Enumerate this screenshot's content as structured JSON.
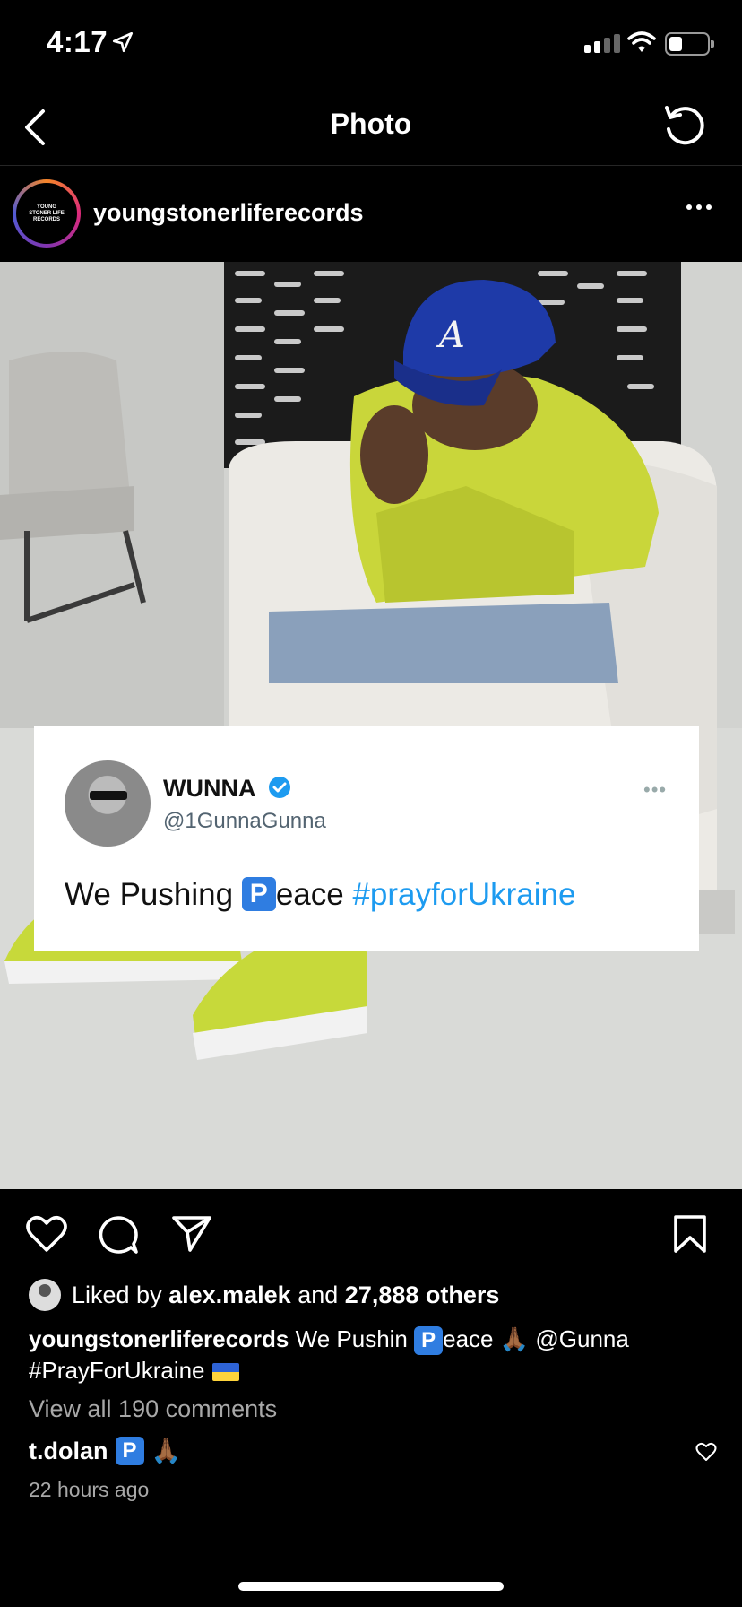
{
  "status_bar": {
    "time": "4:17"
  },
  "nav": {
    "title": "Photo"
  },
  "post": {
    "username": "youngstonerliferecords",
    "avatar_text": "YOUNG STONER LIFE RECORDS"
  },
  "tweet": {
    "name": "WUNNA",
    "handle": "@1GunnaGunna",
    "more": "•••",
    "text_before": "We Pushing",
    "p_letter": "P",
    "text_after": "eace",
    "hashtag": "#prayforUkraine"
  },
  "likes": {
    "prefix": "Liked by",
    "liker": "alex.malek",
    "connector": "and",
    "others": "27,888 others"
  },
  "caption": {
    "username": "youngstonerliferecords",
    "text_before": "We Pushin",
    "p_letter": "P",
    "text_after": "eace",
    "pray_emoji": "🙏🏾",
    "mention": "@Gunna",
    "hashtag": "#PrayForUkraine"
  },
  "comments": {
    "view_all": "View all 190 comments",
    "first": {
      "username": "t.dolan",
      "p_letter": "P",
      "emoji": "🙏🏾"
    },
    "time_ago": "22 hours ago"
  },
  "colors": {
    "background": "#000000",
    "link_blue": "#1d9bf0",
    "muted": "#a8a8a8"
  }
}
